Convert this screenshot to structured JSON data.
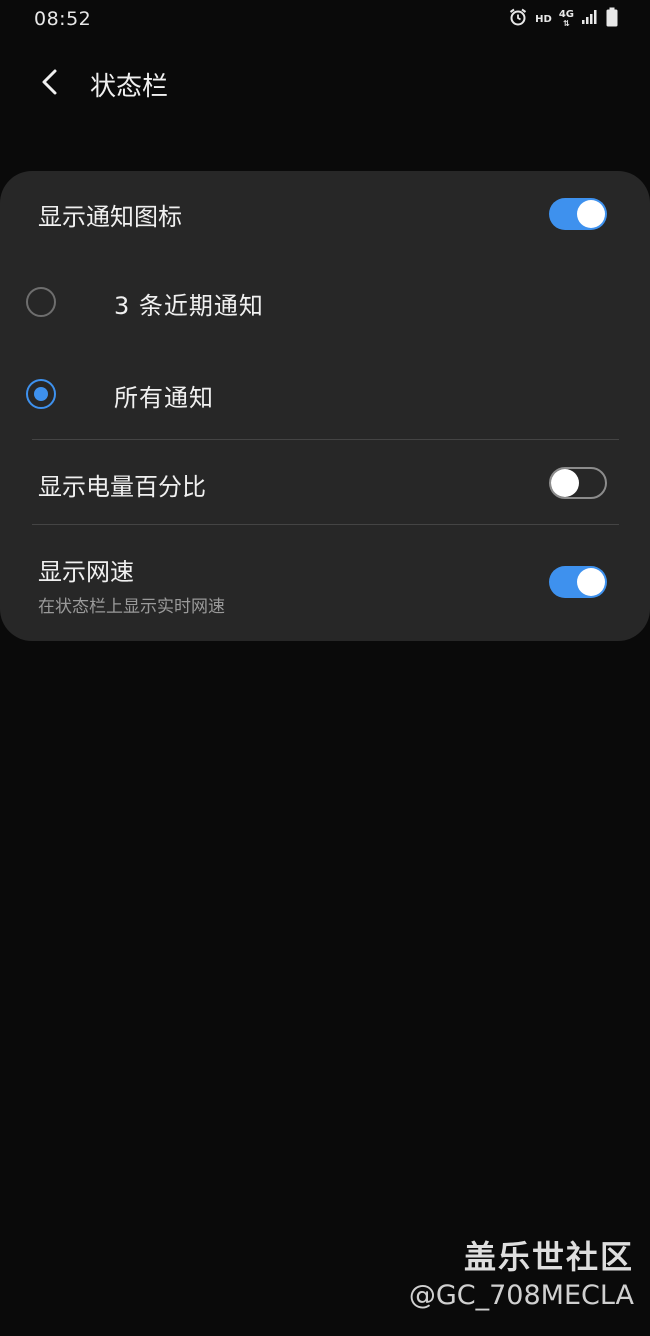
{
  "status_bar": {
    "time": "08:52",
    "hd_label": "HD",
    "network_label": "4G",
    "icons": [
      "alarm-icon",
      "hd-voice-icon",
      "4g-data-icon",
      "signal-icon",
      "battery-icon"
    ]
  },
  "header": {
    "title": "状态栏",
    "back_icon": "chevron-left-icon"
  },
  "settings": {
    "show_notification_icons": {
      "label": "显示通知图标",
      "enabled": true
    },
    "notification_options": [
      {
        "label": "3 条近期通知",
        "selected": false
      },
      {
        "label": "所有通知",
        "selected": true
      }
    ],
    "show_battery_percentage": {
      "label": "显示电量百分比",
      "enabled": false
    },
    "show_network_speed": {
      "label": "显示网速",
      "description": "在状态栏上显示实时网速",
      "enabled": true
    }
  },
  "watermark": {
    "title": "盖乐世社区",
    "user": "@GC_708MECLA"
  },
  "colors": {
    "background": "#0a0a0a",
    "card": "#272727",
    "accent": "#3e91ee",
    "divider": "#444444",
    "secondary_text": "#9a9a9a"
  }
}
